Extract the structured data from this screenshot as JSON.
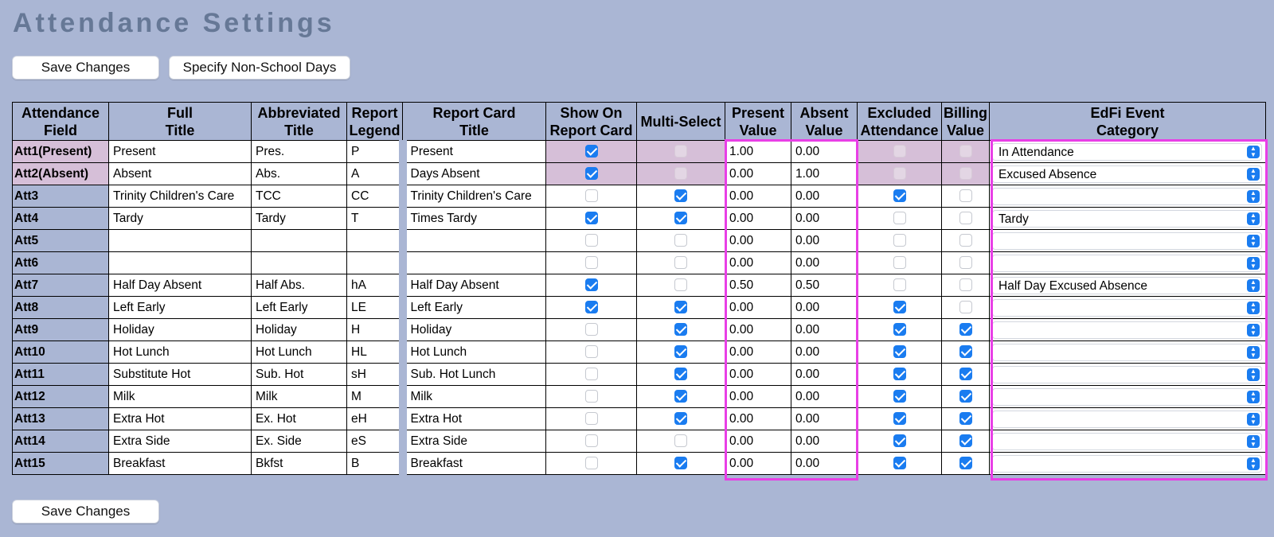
{
  "page_title": "Attendance Settings",
  "buttons": {
    "save_changes": "Save Changes",
    "non_school_days": "Specify Non-School Days"
  },
  "columns": [
    {
      "line1": "Attendance",
      "line2": "Field"
    },
    {
      "line1": "Full",
      "line2": "Title"
    },
    {
      "line1": "Abbreviated",
      "line2": "Title"
    },
    {
      "line1": "Report",
      "line2": "Legend"
    },
    {
      "line1": "Report Card",
      "line2": "Title"
    },
    {
      "line1": "Show On",
      "line2": "Report Card"
    },
    {
      "line1": "Multi-Select",
      "line2": ""
    },
    {
      "line1": "Present",
      "line2": "Value"
    },
    {
      "line1": "Absent",
      "line2": "Value"
    },
    {
      "line1": "Excluded",
      "line2": "Attendance"
    },
    {
      "line1": "Billing",
      "line2": "Value"
    },
    {
      "line1": "EdFi Event",
      "line2": "Category"
    }
  ],
  "rows": [
    {
      "field": "Att1(Present)",
      "full": "Present",
      "abbr": "Pres.",
      "legend": "P",
      "card": "Present",
      "show": true,
      "multi": false,
      "present": "1.00",
      "absent": "0.00",
      "excluded": false,
      "billing": false,
      "edfi": "In Attendance",
      "locked": true
    },
    {
      "field": "Att2(Absent)",
      "full": "Absent",
      "abbr": "Abs.",
      "legend": "A",
      "card": "Days Absent",
      "show": true,
      "multi": false,
      "present": "0.00",
      "absent": "1.00",
      "excluded": false,
      "billing": false,
      "edfi": "Excused Absence",
      "locked": true
    },
    {
      "field": "Att3",
      "full": "Trinity Children's Care",
      "abbr": "TCC",
      "legend": "CC",
      "card": "Trinity Children's Care",
      "show": false,
      "multi": true,
      "present": "0.00",
      "absent": "0.00",
      "excluded": true,
      "billing": false,
      "edfi": "",
      "locked": false
    },
    {
      "field": "Att4",
      "full": "Tardy",
      "abbr": "Tardy",
      "legend": "T",
      "card": "Times Tardy",
      "show": true,
      "multi": true,
      "present": "0.00",
      "absent": "0.00",
      "excluded": false,
      "billing": false,
      "edfi": "Tardy",
      "locked": false
    },
    {
      "field": "Att5",
      "full": "",
      "abbr": "",
      "legend": "",
      "card": "",
      "show": false,
      "multi": false,
      "present": "0.00",
      "absent": "0.00",
      "excluded": false,
      "billing": false,
      "edfi": "",
      "locked": false
    },
    {
      "field": "Att6",
      "full": "",
      "abbr": "",
      "legend": "",
      "card": "",
      "show": false,
      "multi": false,
      "present": "0.00",
      "absent": "0.00",
      "excluded": false,
      "billing": false,
      "edfi": "",
      "locked": false
    },
    {
      "field": "Att7",
      "full": "Half Day Absent",
      "abbr": "Half Abs.",
      "legend": "hA",
      "card": "Half Day Absent",
      "show": true,
      "multi": false,
      "present": "0.50",
      "absent": "0.50",
      "excluded": false,
      "billing": false,
      "edfi": "Half Day Excused Absence",
      "locked": false
    },
    {
      "field": "Att8",
      "full": "Left Early",
      "abbr": "Left Early",
      "legend": "LE",
      "card": "Left Early",
      "show": true,
      "multi": true,
      "present": "0.00",
      "absent": "0.00",
      "excluded": true,
      "billing": false,
      "edfi": "",
      "locked": false
    },
    {
      "field": "Att9",
      "full": "Holiday",
      "abbr": "Holiday",
      "legend": "H",
      "card": "Holiday",
      "show": false,
      "multi": true,
      "present": "0.00",
      "absent": "0.00",
      "excluded": true,
      "billing": true,
      "edfi": "",
      "locked": false
    },
    {
      "field": "Att10",
      "full": "Hot Lunch",
      "abbr": "Hot Lunch",
      "legend": "HL",
      "card": "Hot Lunch",
      "show": false,
      "multi": true,
      "present": "0.00",
      "absent": "0.00",
      "excluded": true,
      "billing": true,
      "edfi": "",
      "locked": false
    },
    {
      "field": "Att11",
      "full": "Substitute Hot",
      "abbr": "Sub. Hot",
      "legend": "sH",
      "card": "Sub. Hot Lunch",
      "show": false,
      "multi": true,
      "present": "0.00",
      "absent": "0.00",
      "excluded": true,
      "billing": true,
      "edfi": "",
      "locked": false
    },
    {
      "field": "Att12",
      "full": "Milk",
      "abbr": "Milk",
      "legend": "M",
      "card": "Milk",
      "show": false,
      "multi": true,
      "present": "0.00",
      "absent": "0.00",
      "excluded": true,
      "billing": true,
      "edfi": "",
      "locked": false
    },
    {
      "field": "Att13",
      "full": "Extra Hot",
      "abbr": "Ex. Hot",
      "legend": "eH",
      "card": "Extra Hot",
      "show": false,
      "multi": true,
      "present": "0.00",
      "absent": "0.00",
      "excluded": true,
      "billing": true,
      "edfi": "",
      "locked": false
    },
    {
      "field": "Att14",
      "full": "Extra Side",
      "abbr": "Ex. Side",
      "legend": "eS",
      "card": "Extra Side",
      "show": false,
      "multi": false,
      "present": "0.00",
      "absent": "0.00",
      "excluded": true,
      "billing": true,
      "edfi": "",
      "locked": false
    },
    {
      "field": "Att15",
      "full": "Breakfast",
      "abbr": "Bkfst",
      "legend": "B",
      "card": "Breakfast",
      "show": false,
      "multi": true,
      "present": "0.00",
      "absent": "0.00",
      "excluded": true,
      "billing": true,
      "edfi": "",
      "locked": false
    }
  ],
  "colors": {
    "background": "#aab6d4",
    "title": "#667896",
    "locked_row": "#d6bfd8",
    "checkbox_on": "#1a7cf0",
    "highlight": "#e83fe6"
  }
}
